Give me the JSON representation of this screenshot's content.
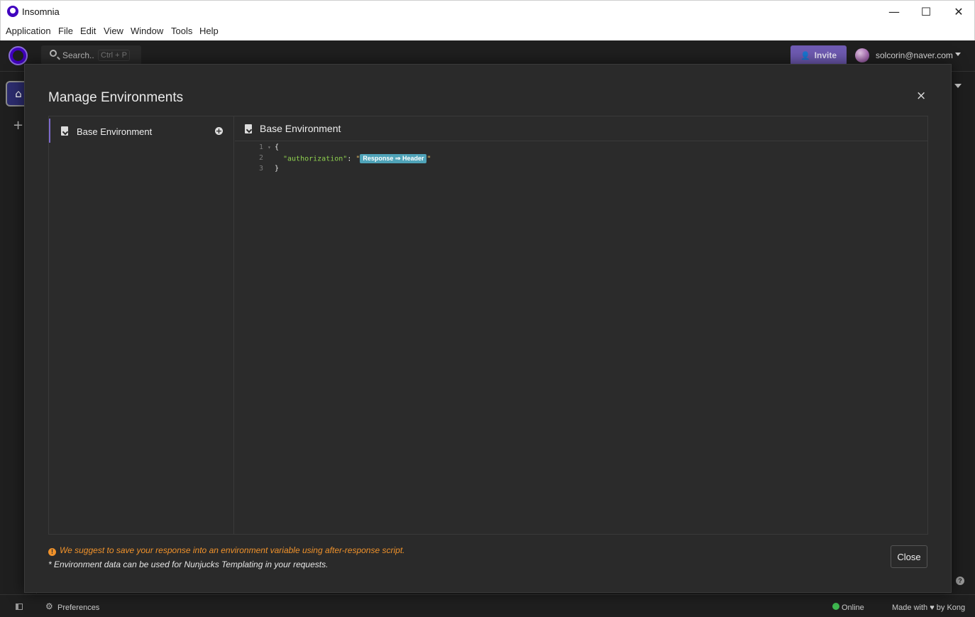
{
  "window": {
    "title": "Insomnia",
    "controls": {
      "minimize": "—",
      "maximize": "☐",
      "close": "✕"
    }
  },
  "menu": [
    "Application",
    "File",
    "Edit",
    "View",
    "Window",
    "Tools",
    "Help"
  ],
  "header": {
    "search_label": "Search..",
    "search_shortcut": "Ctrl + P",
    "invite_label": "Invite",
    "user_email": "solcorin@naver.com"
  },
  "rail": {
    "add_label": "+"
  },
  "modal": {
    "title": "Manage Environments",
    "close_symbol": "×",
    "environments": [
      {
        "name": "Base Environment"
      }
    ],
    "editor_title": "Base Environment",
    "code": {
      "line_numbers": [
        "1",
        "2",
        "3"
      ],
      "open_brace": "{",
      "key": "\"authorization\"",
      "colon": ": ",
      "quote": "\"",
      "tag": "Response ⇒ Header",
      "close_brace": "}"
    },
    "hint": "We suggest to save your response into an environment variable using after-response script.",
    "note": "* Environment data can be used for Nunjucks Templating in your requests.",
    "close_button": "Close"
  },
  "statusbar": {
    "preferences": "Preferences",
    "online": "Online",
    "made_with": "Made with ♥ by Kong"
  },
  "colors": {
    "accent": "#7d69cb",
    "brand": "#4000bf",
    "warning": "#f0922b",
    "online": "#3fb950",
    "tag": "#4fa3b8"
  }
}
